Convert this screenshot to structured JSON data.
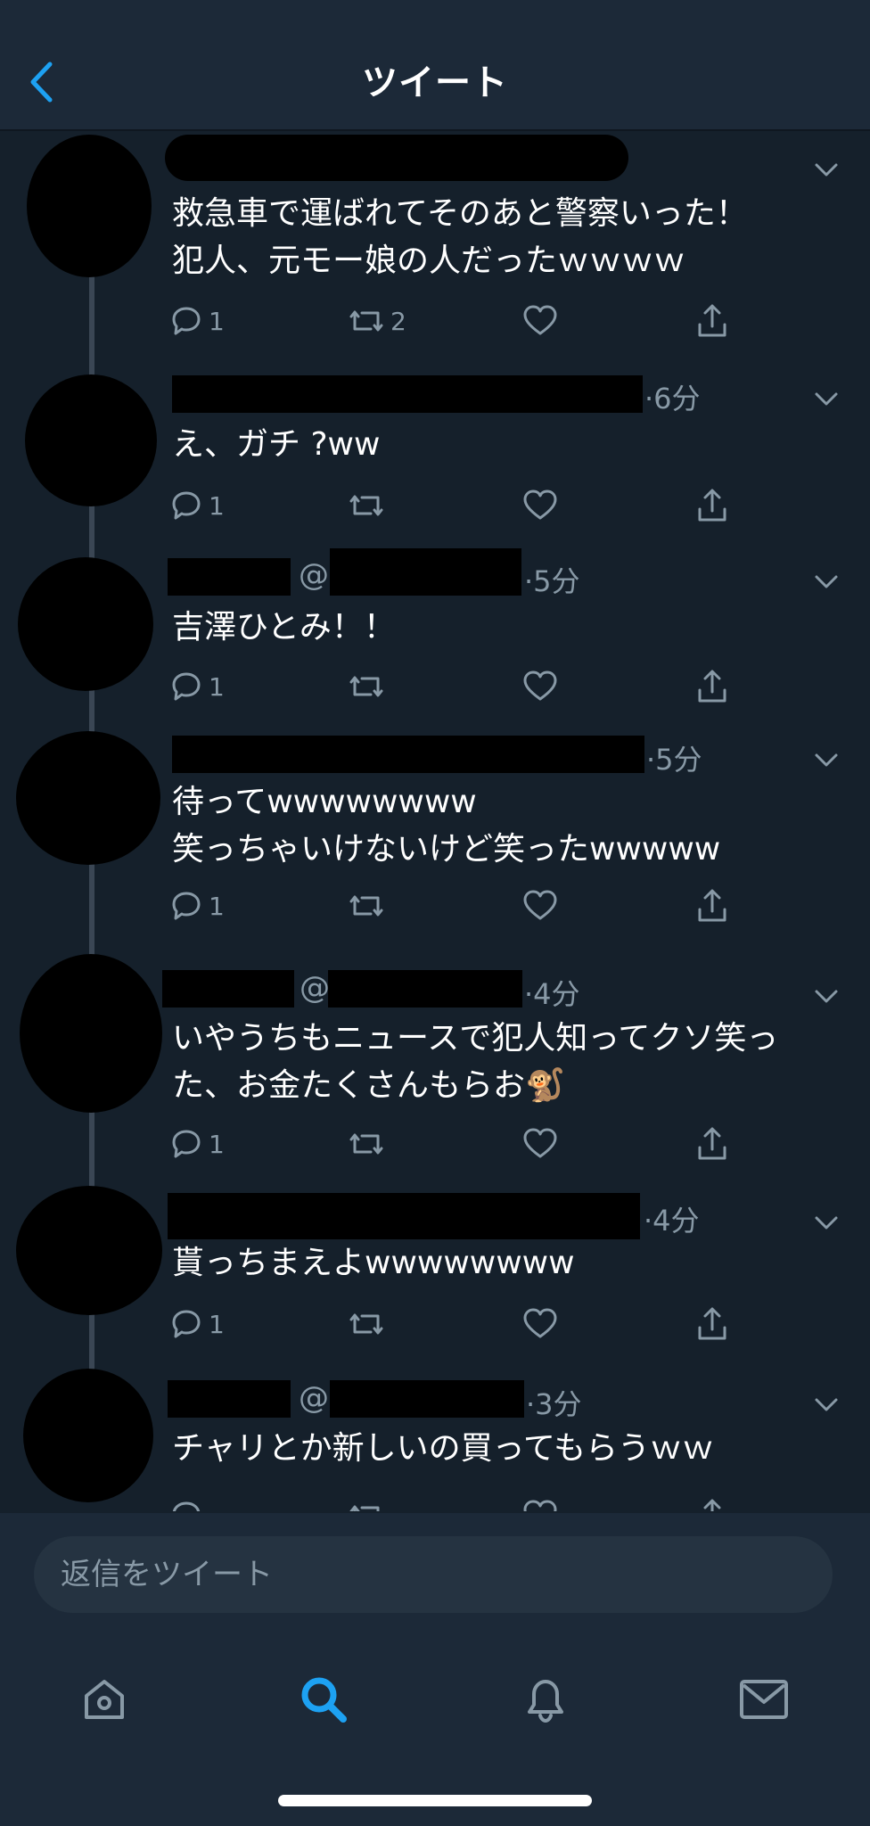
{
  "header": {
    "title": "ツイート",
    "back_icon": "chevron-left-icon"
  },
  "tweets": [
    {
      "at": "",
      "time": "",
      "text": "救急車で運ばれてそのあと警察いった！\n犯人、元モー娘の人だったｗｗｗｗ",
      "reply_count": "1",
      "retweet_count": "2"
    },
    {
      "at": "",
      "time": "·6分",
      "text": "え、ガチ ?ww",
      "reply_count": "1",
      "retweet_count": ""
    },
    {
      "at": "@",
      "time": "·5分",
      "text": "吉澤ひとみ！！",
      "reply_count": "1",
      "retweet_count": ""
    },
    {
      "at": "",
      "time": "·5分",
      "text": "待ってwwwwwwww\n笑っちゃいけないけど笑ったwwwww",
      "reply_count": "1",
      "retweet_count": ""
    },
    {
      "at": "@",
      "time": "·4分",
      "text": "いやうちもニュースで犯人知ってクソ笑った、お金たくさんもらお🐒",
      "reply_count": "1",
      "retweet_count": ""
    },
    {
      "at": "",
      "time": "·4分",
      "text": "貰っちまえよwwwwwwww",
      "reply_count": "1",
      "retweet_count": ""
    },
    {
      "at": "@",
      "time": "·3分",
      "text": "チャリとか新しいの買ってもらうｗｗ",
      "reply_count": "",
      "retweet_count": ""
    }
  ],
  "composer": {
    "placeholder": "返信をツイート"
  },
  "tabbar": {
    "items": [
      "home-icon",
      "search-icon",
      "notifications-icon",
      "messages-icon"
    ],
    "active": "search-icon"
  },
  "colors": {
    "background": "#15202b",
    "bar": "#1c2938",
    "accent": "#1da1f2",
    "muted": "#8899a6"
  }
}
